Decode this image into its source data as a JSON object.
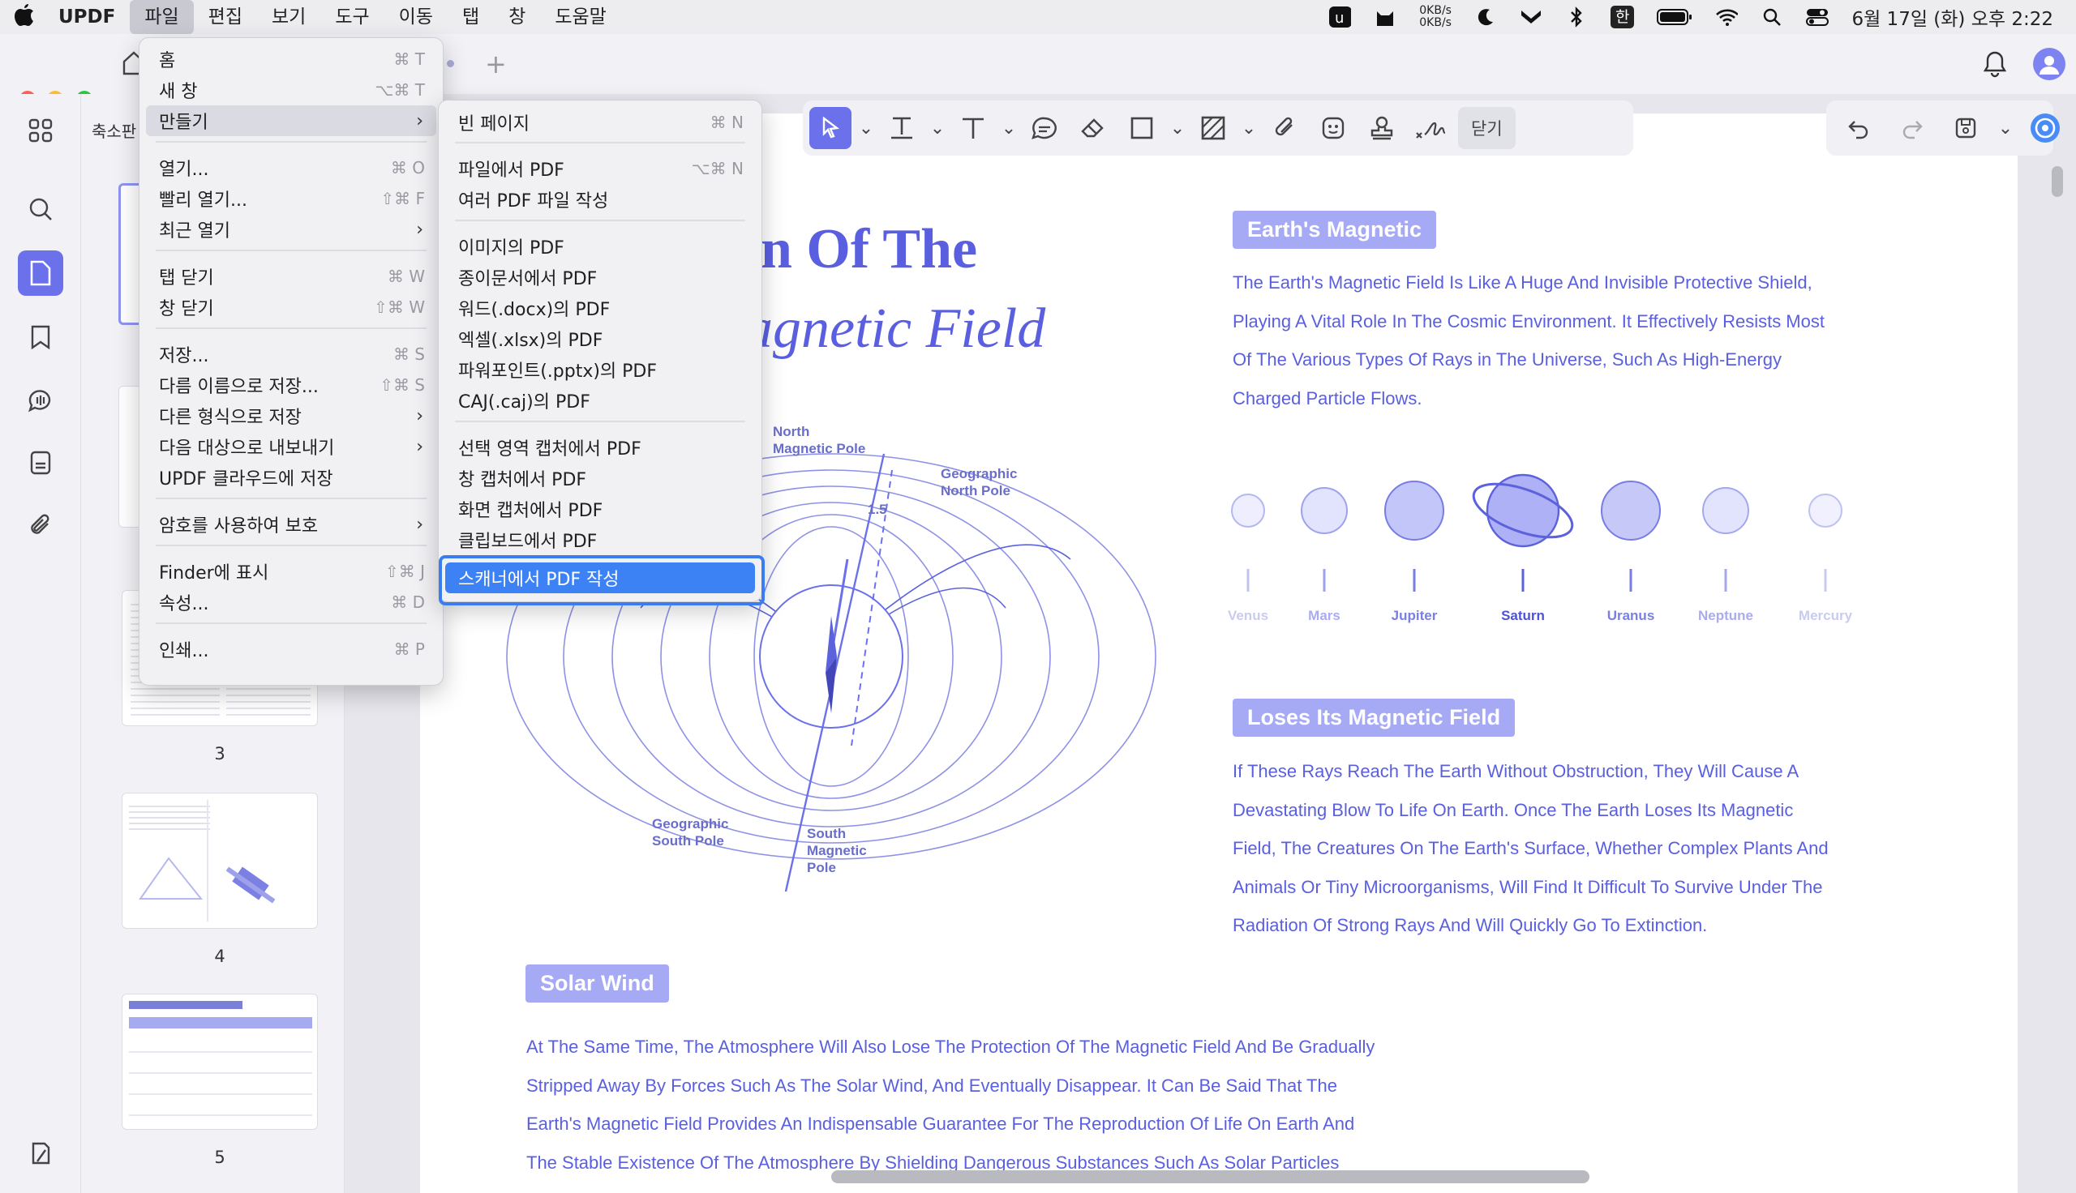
{
  "menubar": {
    "app": "UPDF",
    "items": [
      "파일",
      "편집",
      "보기",
      "도구",
      "이동",
      "탭",
      "창",
      "도움말"
    ],
    "net_up": "0KB/s",
    "net_down": "0KB/s",
    "input_lang": "한",
    "clock": "6월 17일 (화) 오후 2:22"
  },
  "file_menu": {
    "items": [
      {
        "label": "홈",
        "shortcut": "⌘ T"
      },
      {
        "label": "새 창",
        "shortcut": "⌥⌘ T"
      },
      {
        "label": "만들기",
        "submenu": true
      },
      {
        "label": "열기...",
        "shortcut": "⌘ O"
      },
      {
        "label": "빨리 열기...",
        "shortcut": "⇧⌘ F"
      },
      {
        "label": "최근 열기",
        "submenu": true
      },
      {
        "label": "탭 닫기",
        "shortcut": "⌘ W"
      },
      {
        "label": "창 닫기",
        "shortcut": "⇧⌘ W"
      },
      {
        "label": "저장...",
        "shortcut": "⌘ S"
      },
      {
        "label": "다름 이름으로 저장...",
        "shortcut": "⇧⌘ S"
      },
      {
        "label": "다른 형식으로 저장",
        "submenu": true
      },
      {
        "label": "다음 대상으로 내보내기",
        "submenu": true
      },
      {
        "label": "UPDF 클라우드에 저장"
      },
      {
        "label": "암호를 사용하여 보호",
        "submenu": true
      },
      {
        "label": "Finder에 표시",
        "shortcut": "⇧⌘ J"
      },
      {
        "label": "속성...",
        "shortcut": "⌘ D"
      },
      {
        "label": "인쇄...",
        "shortcut": "⌘ P"
      }
    ]
  },
  "create_submenu": {
    "items": [
      {
        "label": "빈 페이지",
        "shortcut": "⌘ N"
      },
      {
        "label": "파일에서 PDF",
        "shortcut": "⌥⌘ N"
      },
      {
        "label": "여러 PDF 파일 작성"
      },
      {
        "label": "이미지의 PDF"
      },
      {
        "label": "종이문서에서 PDF"
      },
      {
        "label": "워드(.docx)의 PDF"
      },
      {
        "label": "엑셀(.xlsx)의 PDF"
      },
      {
        "label": "파워포인트(.pptx)의 PDF"
      },
      {
        "label": "CAJ(.caj)의 PDF"
      },
      {
        "label": "선택 영역 캡처에서 PDF"
      },
      {
        "label": "창 캡처에서 PDF"
      },
      {
        "label": "화면 캡처에서 PDF"
      },
      {
        "label": "클립보드에서 PDF"
      },
      {
        "label": "스캐너에서 PDF 작성"
      }
    ]
  },
  "thumbnails": {
    "panel_label": "축소판",
    "numbers": [
      "3",
      "4",
      "5"
    ]
  },
  "toolbar": {
    "close_label": "닫기"
  },
  "document": {
    "title_line1": "n Of The",
    "title_line2": "agnetic Field",
    "sec1_header": "Earth's Magnetic",
    "sec1_lines": [
      "The Earth's Magnetic Field Is Like A Huge And Invisible Protective Shield,",
      "Playing A Vital Role In The Cosmic Environment. It Effectively Resists Most",
      "Of The Various Types Of Rays in The Universe, Such As High-Energy",
      "Charged Particle Flows."
    ],
    "planets": [
      "Venus",
      "Mars",
      "Jupiter",
      "Saturn",
      "Uranus",
      "Neptune",
      "Mercury"
    ],
    "sec2_header": "Loses Its Magnetic Field",
    "sec2_lines": [
      "If These Rays Reach The Earth Without Obstruction, They Will Cause A",
      "Devastating Blow To Life On Earth. Once The Earth Loses Its Magnetic",
      "Field, The Creatures On The Earth's Surface, Whether Complex Plants And",
      "Animals Or Tiny Microorganisms, Will Find It Difficult To Survive Under The",
      "Radiation Of Strong Rays And Will Quickly Go To Extinction."
    ],
    "sec3_header": "Solar Wind",
    "sec3_lines": [
      "At The Same Time, The Atmosphere Will Also Lose The Protection Of The Magnetic Field And Be Gradually",
      "Stripped Away By Forces Such As The Solar Wind, And Eventually Disappear. It Can Be Said That The",
      "Earth's Magnetic Field Provides An Indispensable Guarantee For The Reproduction Of Life On Earth And",
      "The Stable Existence Of The Atmosphere By Shielding Dangerous Substances Such As Solar Particles"
    ],
    "diagram": {
      "north_magnetic": "North Magnetic Pole",
      "geo_north": "Geographic North Pole",
      "angle": "1.5",
      "geo_south": "Geographic South Pole",
      "south_magnetic": "South Magnetic Pole"
    }
  },
  "colors": {
    "accent": "#6b71ea",
    "doc_text": "#5a5fe0",
    "menu_selection": "#3d82f5"
  }
}
